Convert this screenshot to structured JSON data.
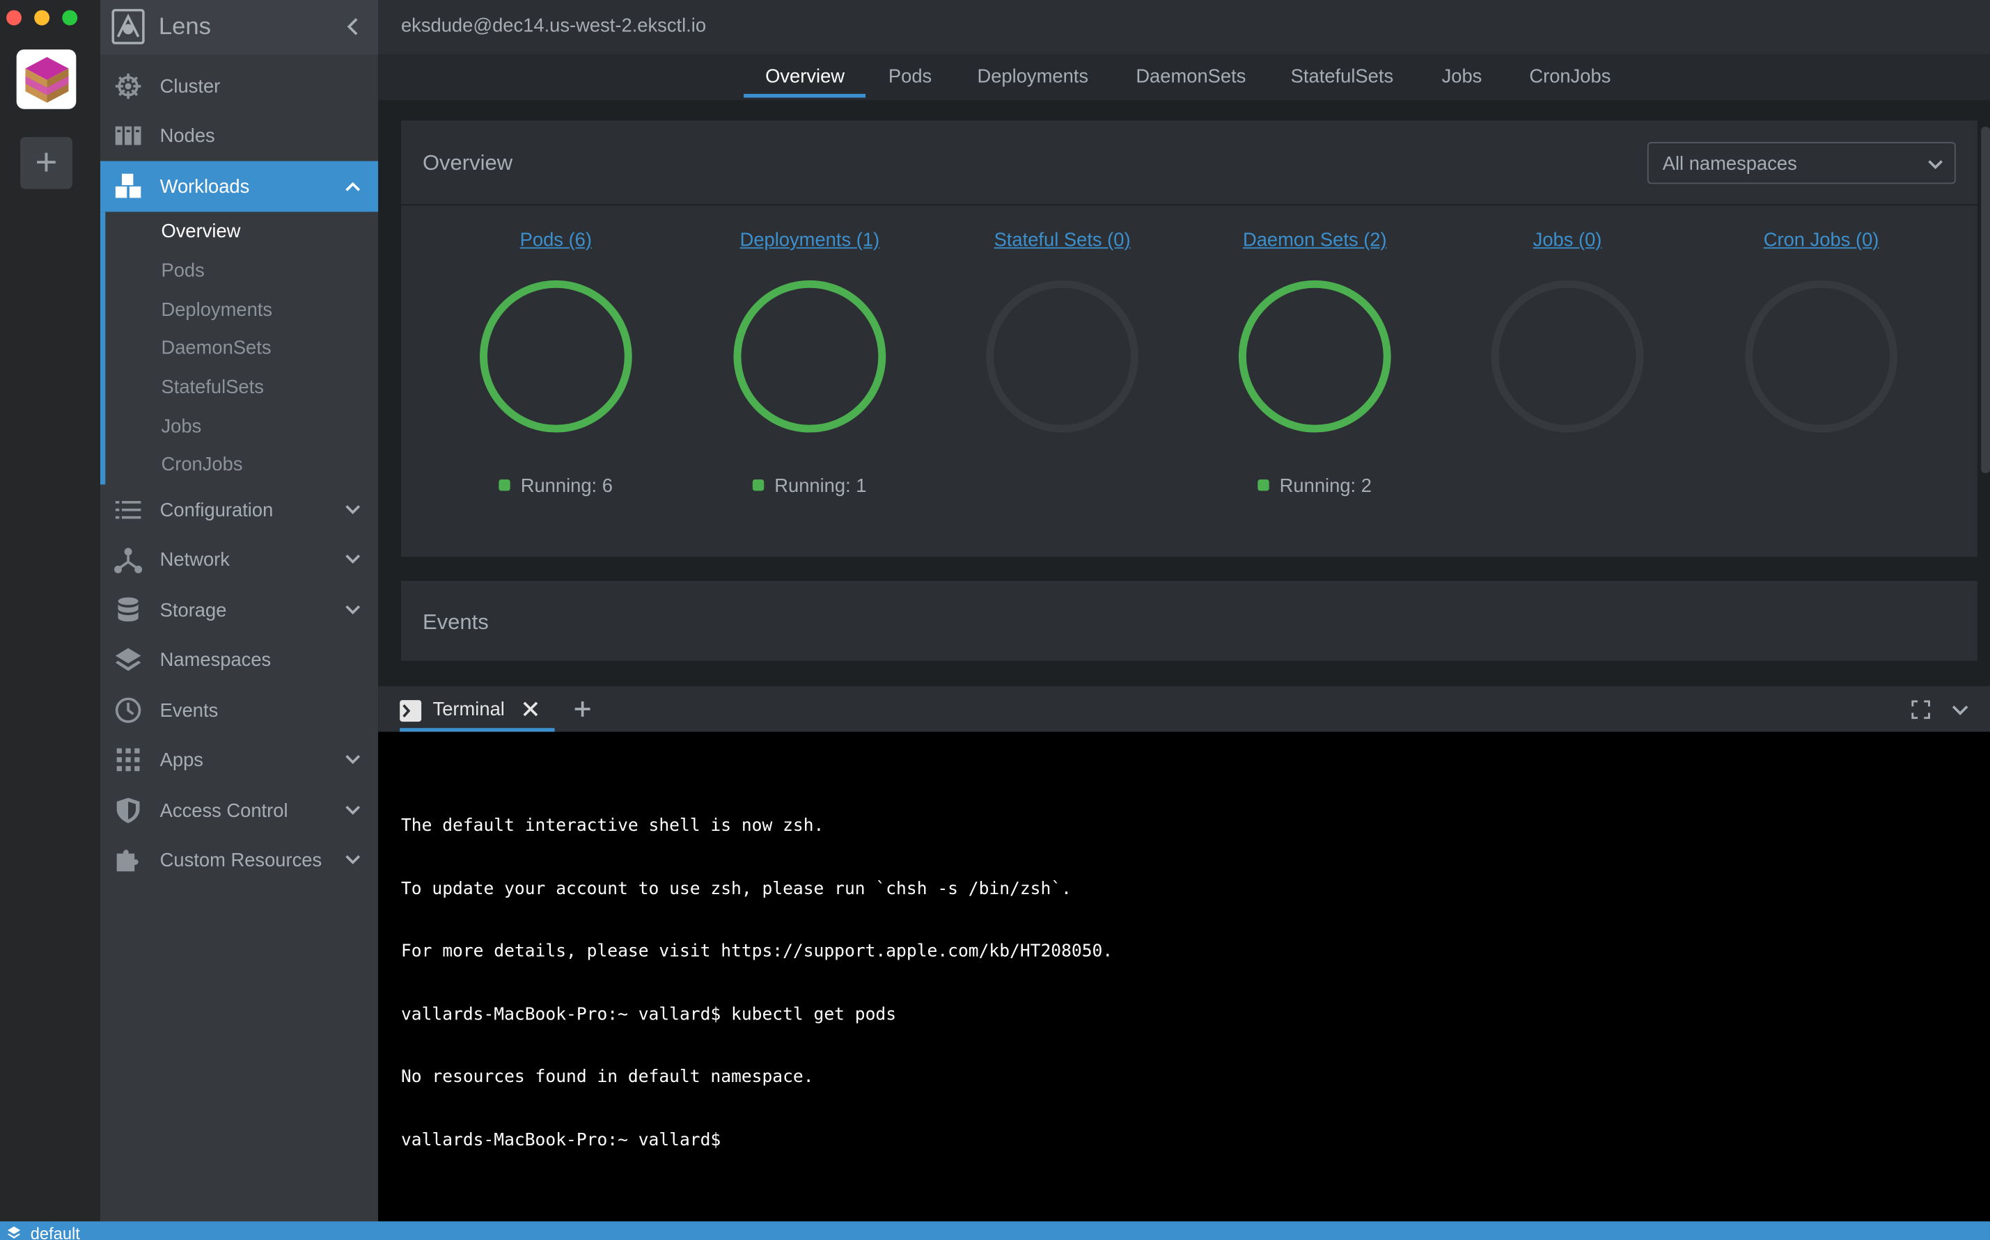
{
  "app": {
    "title": "Lens",
    "cluster_name": "eksdude@dec14.us-west-2.eksctl.io"
  },
  "sidebar": {
    "items": [
      {
        "label": "Cluster",
        "icon": "helm-wheel-icon"
      },
      {
        "label": "Nodes",
        "icon": "server-rack-icon"
      },
      {
        "label": "Workloads",
        "icon": "cubes-icon",
        "active": true,
        "expanded": true
      },
      {
        "label": "Configuration",
        "icon": "list-icon",
        "has_children": true
      },
      {
        "label": "Network",
        "icon": "network-icon",
        "has_children": true
      },
      {
        "label": "Storage",
        "icon": "database-icon",
        "has_children": true
      },
      {
        "label": "Namespaces",
        "icon": "layers-icon"
      },
      {
        "label": "Events",
        "icon": "clock-icon"
      },
      {
        "label": "Apps",
        "icon": "grid-icon",
        "has_children": true
      },
      {
        "label": "Access Control",
        "icon": "shield-icon",
        "has_children": true
      },
      {
        "label": "Custom Resources",
        "icon": "puzzle-icon",
        "has_children": true
      }
    ],
    "workloads_sub": [
      "Overview",
      "Pods",
      "Deployments",
      "DaemonSets",
      "StatefulSets",
      "Jobs",
      "CronJobs"
    ],
    "workloads_active_sub": "Overview"
  },
  "tabs": [
    "Overview",
    "Pods",
    "Deployments",
    "DaemonSets",
    "StatefulSets",
    "Jobs",
    "CronJobs"
  ],
  "active_tab": "Overview",
  "overview": {
    "title": "Overview",
    "namespace_select": "All namespaces",
    "workloads": [
      {
        "label": "Pods (6)",
        "running": 6,
        "status": "Running: 6"
      },
      {
        "label": "Deployments (1)",
        "running": 1,
        "status": "Running: 1"
      },
      {
        "label": "Stateful Sets (0)",
        "running": 0,
        "status": ""
      },
      {
        "label": "Daemon Sets (2)",
        "running": 2,
        "status": "Running: 2"
      },
      {
        "label": "Jobs (0)",
        "running": 0,
        "status": ""
      },
      {
        "label": "Cron Jobs (0)",
        "running": 0,
        "status": ""
      }
    ]
  },
  "events": {
    "title": "Events"
  },
  "terminal": {
    "tab_label": "Terminal",
    "lines": [
      "The default interactive shell is now zsh.",
      "To update your account to use zsh, please run `chsh -s /bin/zsh`.",
      "For more details, please visit https://support.apple.com/kb/HT208050.",
      "vallards-MacBook-Pro:~ vallard$ kubectl get pods",
      "No resources found in default namespace.",
      "vallards-MacBook-Pro:~ vallard$"
    ]
  },
  "statusbar": {
    "namespace": "default"
  },
  "colors": {
    "accent": "#3d90ce",
    "running": "#4caf50",
    "empty_ring": "#363a3f"
  }
}
